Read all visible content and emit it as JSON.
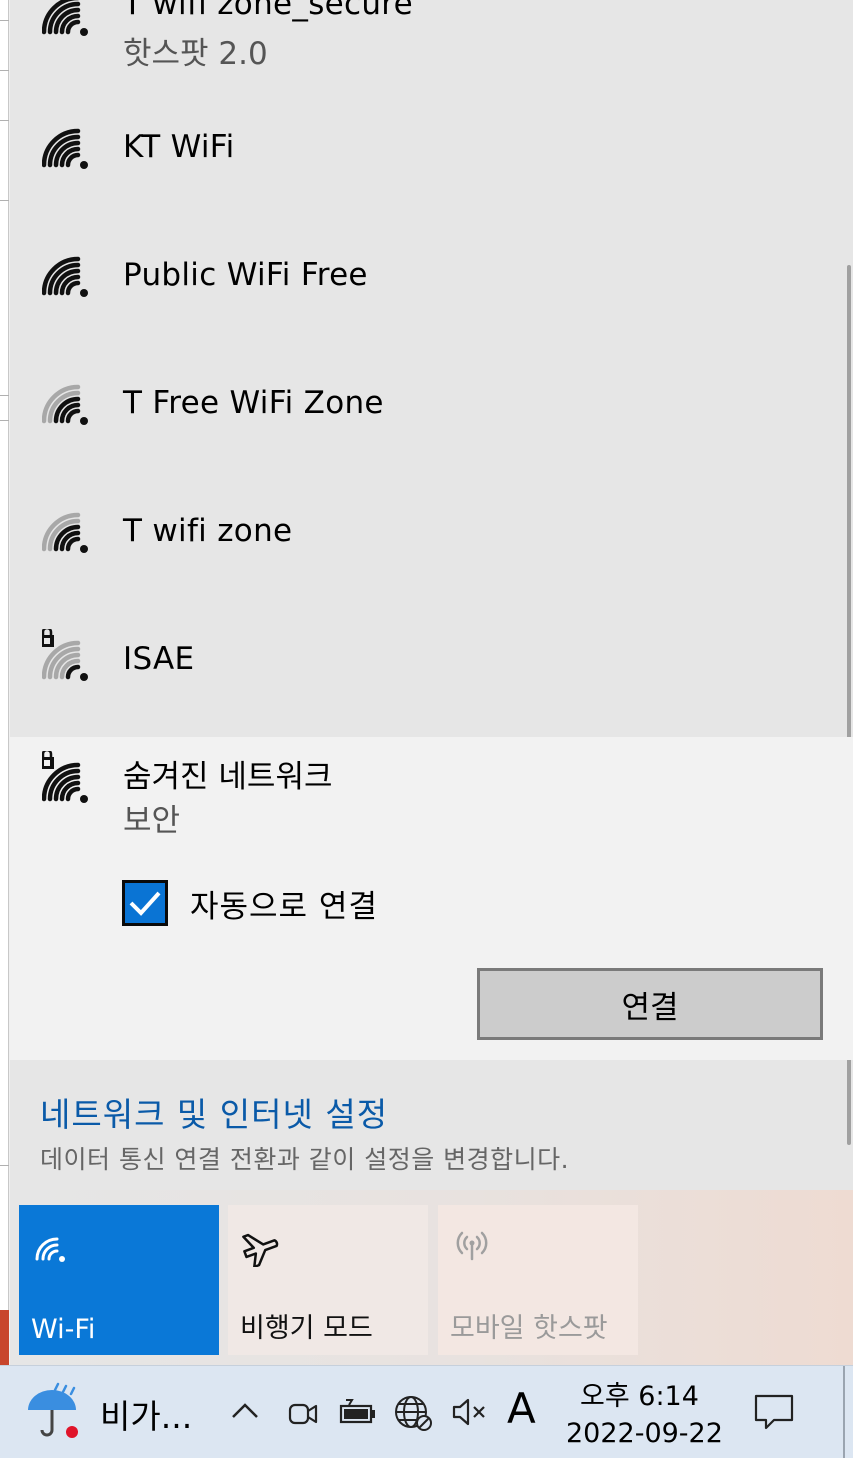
{
  "networks": [
    {
      "name": "T wifi zone_secure",
      "status": "핫스팟 2.0",
      "icon": "wifi-signal-full-icon"
    },
    {
      "name": "KT WiFi",
      "icon": "wifi-signal-full-icon"
    },
    {
      "name": "Public WiFi Free",
      "icon": "wifi-signal-full-icon"
    },
    {
      "name": "T Free WiFi Zone",
      "icon": "wifi-signal-medium-icon"
    },
    {
      "name": "T wifi zone",
      "icon": "wifi-signal-medium-icon"
    },
    {
      "name": "ISAE",
      "icon": "wifi-secured-weak-icon"
    }
  ],
  "selected_network": {
    "name": "숨겨진 네트워크",
    "status": "보안",
    "icon": "wifi-secured-full-icon",
    "auto_connect_label": "자동으로 연결",
    "auto_connect_checked": true,
    "connect_label": "연결"
  },
  "settings": {
    "title": "네트워크 및 인터넷 설정",
    "description": "데이터 통신 연결 전환과 같이 설정을 변경합니다."
  },
  "quick_actions": [
    {
      "label": "Wi-Fi",
      "icon": "wifi-icon",
      "active": true
    },
    {
      "label": "비행기 모드",
      "icon": "airplane-icon",
      "active": false
    },
    {
      "label": "모바일 핫스팟",
      "icon": "hotspot-icon",
      "active": false,
      "disabled": true
    }
  ],
  "taskbar": {
    "weather_text": "비가...",
    "weather_icon": "rain-umbrella-icon",
    "ime": "A",
    "time": "오후 6:14",
    "date": "2022-09-22"
  },
  "colors": {
    "accent": "#0a78d7",
    "link": "#0a5aa8",
    "flyout_bg": "#e6e6e6",
    "selected_bg": "#f2f2f2",
    "taskbar_bg": "#dce6f2"
  }
}
